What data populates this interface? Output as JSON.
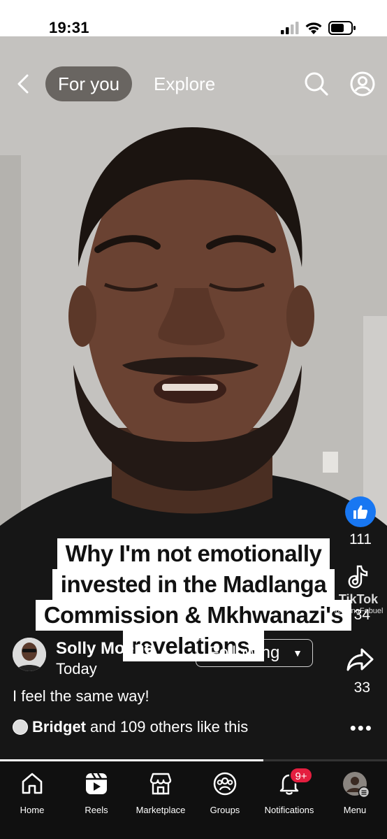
{
  "status_bar": {
    "time": "19:31",
    "icons": [
      "signal-icon",
      "wifi-icon",
      "battery-icon"
    ]
  },
  "top_nav": {
    "back_icon": "chevron-left-icon",
    "tabs": [
      {
        "label": "For you",
        "active": true
      },
      {
        "label": "Explore",
        "active": false
      }
    ],
    "search_icon": "search-icon",
    "profile_icon": "profile-icon"
  },
  "caption": {
    "lines": [
      "Why I'm not emotionally",
      "invested in the Madlanga",
      "Commission & Mkhwanazi's",
      "revelations."
    ]
  },
  "actions": {
    "like_count": "111",
    "watermark_text": "TikTok",
    "watermark_user": "@SonaFebuel",
    "comment_count": "34",
    "share_count": "33"
  },
  "author": {
    "name": "Solly Moeng",
    "time": "Today",
    "follow_label": "Following",
    "follow_icon": "chevron-down-icon"
  },
  "post": {
    "text": "I feel the same way!",
    "likes_bold": "Bridget",
    "likes_rest": "and 109 others like this",
    "more_icon": "more-horizontal-icon"
  },
  "progress": {
    "fraction": 0.68
  },
  "bottom_nav": {
    "items": [
      {
        "label": "Home",
        "icon": "home-icon"
      },
      {
        "label": "Reels",
        "icon": "reels-icon"
      },
      {
        "label": "Marketplace",
        "icon": "marketplace-icon"
      },
      {
        "label": "Groups",
        "icon": "groups-icon"
      },
      {
        "label": "Notifications",
        "icon": "bell-icon",
        "badge": "9+"
      },
      {
        "label": "Menu",
        "icon": "menu-avatar-icon"
      }
    ]
  },
  "colors": {
    "like_blue": "#1877f2",
    "badge_red": "#e41e3f",
    "nav_bg": "#101010"
  }
}
